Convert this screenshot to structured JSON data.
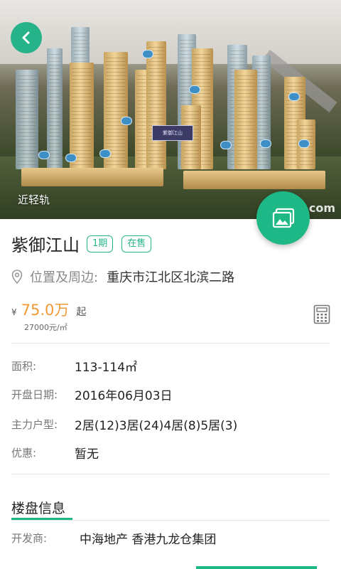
{
  "hero": {
    "caption": "近轻轨",
    "watermark": ".com",
    "sign_text": "紫御江山"
  },
  "back_icon": "chevron-left-icon",
  "gallery_icon": "gallery-icon",
  "project": {
    "name": "紫御江山",
    "tags": [
      "1期",
      "在售"
    ]
  },
  "location": {
    "label": "位置及周边:",
    "value": "重庆市江北区北滨二路"
  },
  "price": {
    "currency": "¥",
    "total": "75.0万",
    "suffix": "起",
    "unit": "27000元/㎡"
  },
  "details": [
    {
      "label": "面积:",
      "value": "113-114㎡"
    },
    {
      "label": "开盘日期:",
      "value": "2016年06月03日"
    },
    {
      "label": "主力户型:",
      "value": "2居(12)3居(24)4居(8)5居(3)"
    },
    {
      "label": "优惠:",
      "value": "暂无"
    }
  ],
  "section": {
    "title": "楼盘信息"
  },
  "developer": {
    "label": "开发商:",
    "value": "中海地产 香港九龙仓集团"
  },
  "colors": {
    "accent": "#1eb887",
    "price": "#f29a36"
  }
}
